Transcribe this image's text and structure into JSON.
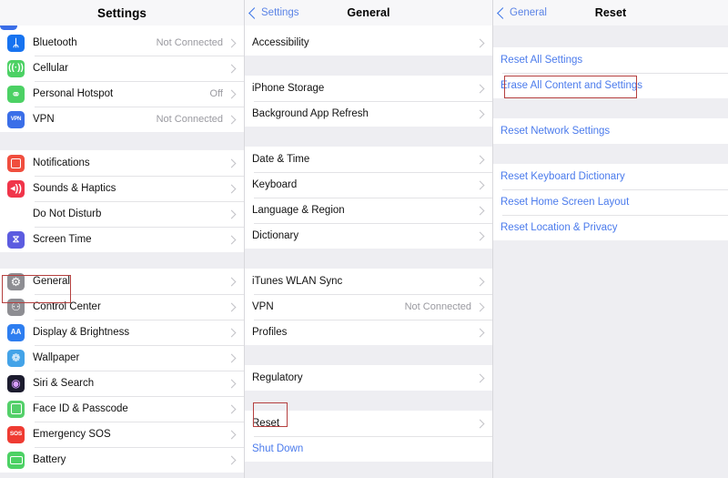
{
  "panels": {
    "settings": {
      "nav": {
        "title": "Settings"
      },
      "groups": [
        {
          "rows": [
            {
              "icon": "bluetooth-icon",
              "icon_color": "#1773f0",
              "label": "Bluetooth",
              "value": "Not Connected",
              "chevron": true
            },
            {
              "icon": "cellular-icon",
              "icon_color": "#4cd164",
              "label": "Cellular",
              "value": "",
              "chevron": true
            },
            {
              "icon": "personal-hotspot-icon",
              "icon_color": "#4cd164",
              "label": "Personal Hotspot",
              "value": "Off",
              "chevron": true
            },
            {
              "icon": "vpn-icon",
              "icon_color": "#3a6ee8",
              "label": "VPN",
              "value": "Not Connected",
              "chevron": true
            }
          ]
        },
        {
          "rows": [
            {
              "icon": "notifications-icon",
              "icon_color": "#f04e3e",
              "label": "Notifications",
              "value": "",
              "chevron": true
            },
            {
              "icon": "sounds-haptics-icon",
              "icon_color": "#f0354a",
              "label": "Sounds & Haptics",
              "value": "",
              "chevron": true
            },
            {
              "icon": "do-not-disturb-icon",
              "icon_color": "#5а5ae0",
              "label": "Do Not Disturb",
              "value": "",
              "chevron": true
            },
            {
              "icon": "screen-time-icon",
              "icon_color": "#5c5ce0",
              "label": "Screen Time",
              "value": "",
              "chevron": true
            }
          ]
        },
        {
          "rows": [
            {
              "icon": "general-gear-icon",
              "icon_color": "#8e8e93",
              "label": "General",
              "value": "",
              "chevron": true
            },
            {
              "icon": "control-center-icon",
              "icon_color": "#8e8e93",
              "label": "Control Center",
              "value": "",
              "chevron": true
            },
            {
              "icon": "display-brightness-icon",
              "icon_color": "#2e7ef0",
              "label": "Display & Brightness",
              "value": "",
              "chevron": true
            },
            {
              "icon": "wallpaper-icon",
              "icon_color": "#43a3e8",
              "label": "Wallpaper",
              "value": "",
              "chevron": true
            },
            {
              "icon": "siri-search-icon",
              "icon_color": "#1c1c2e",
              "label": "Siri & Search",
              "value": "",
              "chevron": true
            },
            {
              "icon": "face-id-passcode-icon",
              "icon_color": "#54d06a",
              "label": "Face ID & Passcode",
              "value": "",
              "chevron": true
            },
            {
              "icon": "emergency-sos-icon",
              "icon_color": "#ef3b32",
              "label": "Emergency SOS",
              "value": "",
              "chevron": true
            },
            {
              "icon": "battery-icon",
              "icon_color": "#4cd164",
              "label": "Battery",
              "value": "",
              "chevron": true
            }
          ]
        }
      ],
      "highlight": {
        "target": "General"
      }
    },
    "general": {
      "nav": {
        "back_label": "Settings",
        "title": "General"
      },
      "groups": [
        {
          "rows": [
            {
              "label": "Accessibility",
              "value": "",
              "chevron": true
            }
          ]
        },
        {
          "rows": [
            {
              "label": "iPhone Storage",
              "value": "",
              "chevron": true
            },
            {
              "label": "Background App Refresh",
              "value": "",
              "chevron": true
            }
          ]
        },
        {
          "rows": [
            {
              "label": "Date & Time",
              "value": "",
              "chevron": true
            },
            {
              "label": "Keyboard",
              "value": "",
              "chevron": true
            },
            {
              "label": "Language & Region",
              "value": "",
              "chevron": true
            },
            {
              "label": "Dictionary",
              "value": "",
              "chevron": true
            }
          ]
        },
        {
          "rows": [
            {
              "label": "iTunes WLAN Sync",
              "value": "",
              "chevron": true
            },
            {
              "label": "VPN",
              "value": "Not Connected",
              "chevron": true
            },
            {
              "label": "Profiles",
              "value": "",
              "chevron": true
            }
          ]
        },
        {
          "rows": [
            {
              "label": "Regulatory",
              "value": "",
              "chevron": true
            }
          ]
        },
        {
          "rows": [
            {
              "label": "Reset",
              "value": "",
              "chevron": true
            },
            {
              "label": "Shut Down",
              "value": "",
              "chevron": false,
              "link": true
            }
          ]
        }
      ],
      "highlight": {
        "target": "Reset"
      }
    },
    "reset": {
      "nav": {
        "back_label": "General",
        "title": "Reset"
      },
      "groups": [
        {
          "rows": [
            {
              "label": "Reset All Settings",
              "link": true,
              "chevron": false
            },
            {
              "label": "Erase All Content and Settings",
              "link": true,
              "chevron": false
            }
          ]
        },
        {
          "rows": [
            {
              "label": "Reset Network Settings",
              "link": true,
              "chevron": false
            }
          ]
        },
        {
          "rows": [
            {
              "label": "Reset Keyboard Dictionary",
              "link": true,
              "chevron": false
            },
            {
              "label": "Reset Home Screen Layout",
              "link": true,
              "chevron": false
            },
            {
              "label": "Reset Location & Privacy",
              "link": true,
              "chevron": false
            }
          ]
        }
      ],
      "highlight": {
        "target": "Erase All Content and Settings"
      }
    }
  },
  "colors": {
    "accent_link": "#4b7bec",
    "highlight_border": "#b5403f",
    "list_background": "#eeeef2",
    "row_background": "#ffffff",
    "separator": "#e3e3e6",
    "secondary_text": "#9a9aa0"
  }
}
